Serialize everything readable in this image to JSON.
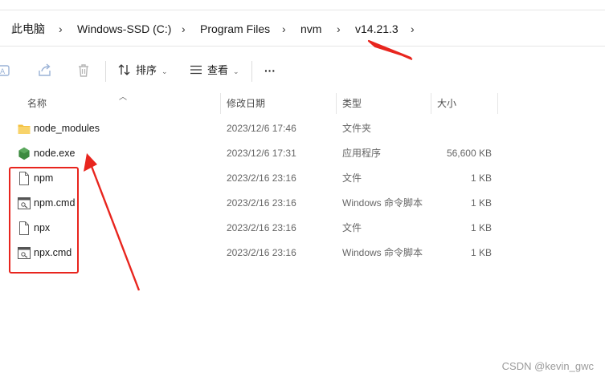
{
  "breadcrumb": {
    "items": [
      "此电脑",
      "Windows-SSD (C:)",
      "Program Files",
      "nvm",
      "v14.21.3"
    ],
    "separator": "›"
  },
  "toolbar": {
    "sort_label": "排序",
    "view_label": "查看",
    "more_label": "···"
  },
  "columns": {
    "name": "名称",
    "date": "修改日期",
    "type": "类型",
    "size": "大小"
  },
  "files": [
    {
      "name": "node_modules",
      "date": "2023/12/6 17:46",
      "type": "文件夹",
      "size": "",
      "icon": "folder-icon"
    },
    {
      "name": "node.exe",
      "date": "2023/12/6 17:31",
      "type": "应用程序",
      "size": "56,600 KB",
      "icon": "nodejs-app-icon"
    },
    {
      "name": "npm",
      "date": "2023/2/16 23:16",
      "type": "文件",
      "size": "1 KB",
      "icon": "file-icon"
    },
    {
      "name": "npm.cmd",
      "date": "2023/2/16 23:16",
      "type": "Windows 命令脚本",
      "size": "1 KB",
      "icon": "cmd-script-icon"
    },
    {
      "name": "npx",
      "date": "2023/2/16 23:16",
      "type": "文件",
      "size": "1 KB",
      "icon": "file-icon"
    },
    {
      "name": "npx.cmd",
      "date": "2023/2/16 23:16",
      "type": "Windows 命令脚本",
      "size": "1 KB",
      "icon": "cmd-script-icon"
    }
  ],
  "watermark": "CSDN @kevin_gwc",
  "colors": {
    "annotation": "#e8251e",
    "folder": "#f4c141",
    "node_green": "#3c8a3f"
  }
}
